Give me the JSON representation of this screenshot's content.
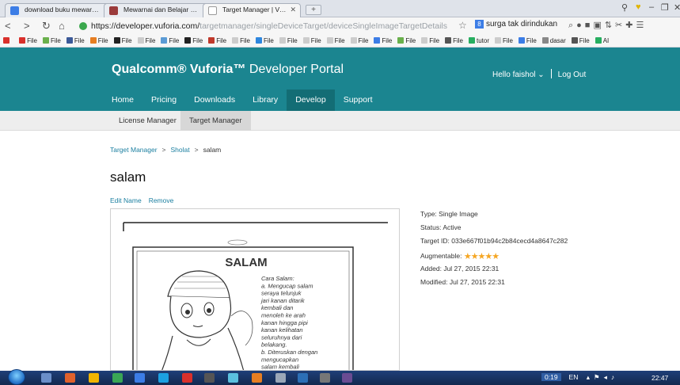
{
  "browser": {
    "tabs": [
      {
        "label": "download buku mewarnai",
        "color": "#3c7de6"
      },
      {
        "label": "Mewarnai dan Belajar Gera",
        "color": "#9b3b3b"
      },
      {
        "label": "Target Manager | Vuforia D",
        "color": "#d7d7d7"
      }
    ],
    "new_tab": "+",
    "url_host": "https://developer.vuforia.com/",
    "url_path": "targetmanager/singleDeviceTarget/deviceSingleImageTargetDetails",
    "search_extension_text": "surga tak dirindukan",
    "bookmarks": [
      {
        "label": "File",
        "color": "#d9302b"
      },
      {
        "label": "File",
        "color": "#6ab04c"
      },
      {
        "label": "File",
        "color": "#3b5998"
      },
      {
        "label": "File",
        "color": "#e67e22"
      },
      {
        "label": "File",
        "color": "#222222"
      },
      {
        "label": "File",
        "color": "#cccccc"
      },
      {
        "label": "File",
        "color": "#5b9bd5"
      },
      {
        "label": "File",
        "color": "#222222"
      },
      {
        "label": "File",
        "color": "#c0392b"
      },
      {
        "label": "File",
        "color": "#cccccc"
      },
      {
        "label": "File",
        "color": "#2e86de"
      },
      {
        "label": "File",
        "color": "#cccccc"
      },
      {
        "label": "File",
        "color": "#cccccc"
      },
      {
        "label": "File",
        "color": "#cccccc"
      },
      {
        "label": "File",
        "color": "#cccccc"
      },
      {
        "label": "File",
        "color": "#3c7de6"
      },
      {
        "label": "File",
        "color": "#6ab04c"
      },
      {
        "label": "File",
        "color": "#cccccc"
      },
      {
        "label": "File",
        "color": "#555555"
      },
      {
        "label": "tutor",
        "color": "#27ae60"
      },
      {
        "label": "File",
        "color": "#cccccc"
      },
      {
        "label": "File",
        "color": "#3c7de6"
      },
      {
        "label": "dasar",
        "color": "#888888"
      },
      {
        "label": "File",
        "color": "#555555"
      },
      {
        "label": "AI",
        "color": "#27ae60"
      }
    ]
  },
  "site": {
    "brand_bold": "Qualcomm® Vuforia™",
    "brand_rest": " Developer Portal",
    "user_greeting": "Hello faishol",
    "logout": "Log Out",
    "nav": [
      "Home",
      "Pricing",
      "Downloads",
      "Library",
      "Develop",
      "Support"
    ],
    "subnav": [
      "License Manager",
      "Target Manager"
    ],
    "breadcrumb": [
      "Target Manager",
      "Sholat",
      "salam"
    ],
    "breadcrumb_sep": ">",
    "target_name": "salam",
    "actions": [
      "Edit Name",
      "Remove"
    ]
  },
  "target_image": {
    "heading": "SALAM",
    "lines": [
      "Cara Salam:",
      "a. Mengucap salam",
      "   seraya telunjuk",
      "   jari kanan ditarik",
      "   kembali dan",
      "   menoleh ke arah",
      "   kanan hingga pipi",
      "   kanan kelihatan",
      "   seluruhnya dari",
      "   belakang.",
      "b. Diteruskan dengan",
      "   mengucapkan",
      "   salam kembali",
      "   seraya menoleh ke"
    ]
  },
  "details": {
    "type_label": "Type:",
    "type_value": "Single Image",
    "status_label": "Status:",
    "status_value": "Active",
    "id_label": "Target ID:",
    "id_value": "033e667f01b94c2b84cecd4a8647c282",
    "augmentable_label": "Augmentable:",
    "augmentable_stars": "★★★★★",
    "augmentable_rating": 5,
    "added_label": "Added:",
    "added_value": "Jul 27, 2015 22:31",
    "modified_label": "Modified:",
    "modified_value": "Jul 27, 2015 22:31"
  },
  "taskbar": {
    "time_elapsed": "0:19",
    "lang": "EN",
    "clock": "22:47"
  }
}
